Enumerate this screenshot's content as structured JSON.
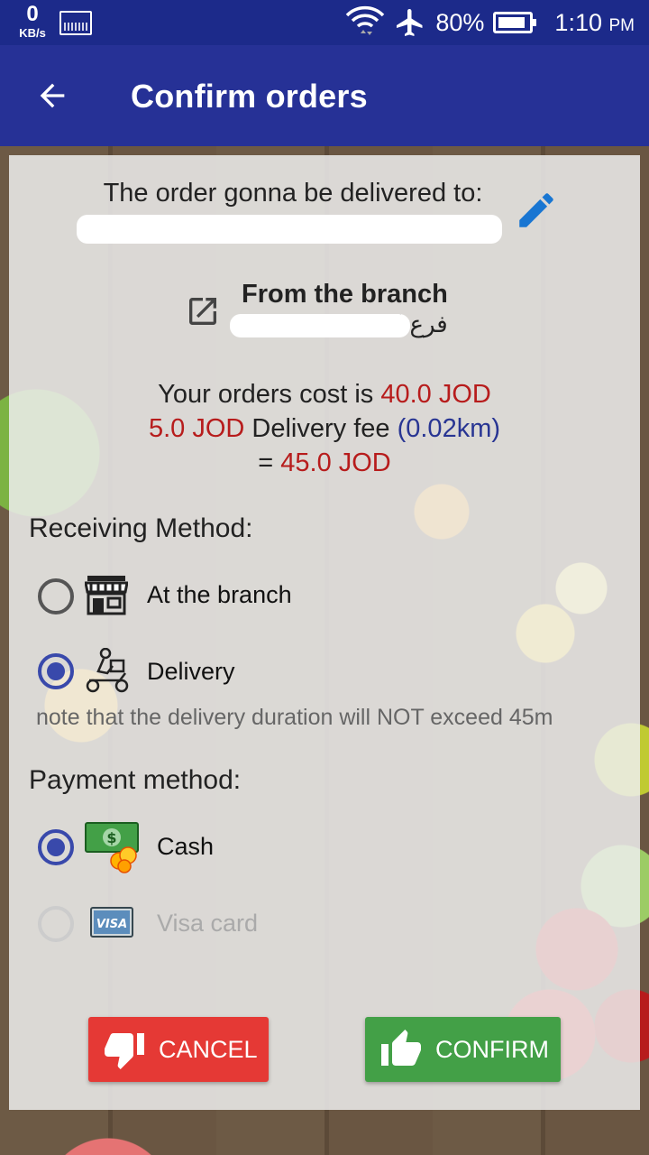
{
  "status_bar": {
    "speed_value": "0",
    "speed_unit": "KB/s",
    "battery": "80%",
    "time": "1:10",
    "ampm": "PM"
  },
  "app_bar": {
    "title": "Confirm orders"
  },
  "delivery": {
    "label": "The order gonna be delivered to:"
  },
  "branch": {
    "title": "From the branch",
    "name": "فرع ا"
  },
  "cost": {
    "line1_prefix": "Your orders cost is ",
    "orders_cost": "40.0 JOD",
    "delivery_fee_amount": "5.0 JOD",
    "delivery_fee_label": " Delivery fee ",
    "distance": "(0.02km)",
    "equals": "= ",
    "total": "45.0 JOD"
  },
  "receiving_method": {
    "label": "Receiving Method:",
    "options": [
      {
        "label": "At the branch",
        "icon": "store-icon",
        "selected": false
      },
      {
        "label": "Delivery",
        "icon": "delivery-scooter-icon",
        "selected": true
      }
    ],
    "note": "note that the delivery duration will NOT exceed 45m"
  },
  "payment_method": {
    "label": "Payment method:",
    "options": [
      {
        "label": "Cash",
        "icon": "cash-icon",
        "selected": true,
        "enabled": true
      },
      {
        "label": "Visa card",
        "icon": "visa-card-icon",
        "selected": false,
        "enabled": false
      }
    ]
  },
  "buttons": {
    "cancel": "CANCEL",
    "confirm": "CONFIRM"
  },
  "colors": {
    "status_bar": "#1c2a8a",
    "app_bar": "#263196",
    "accent": "#3949ab",
    "price_red": "#b71c1c",
    "cancel": "#e53935",
    "confirm": "#43a047"
  }
}
